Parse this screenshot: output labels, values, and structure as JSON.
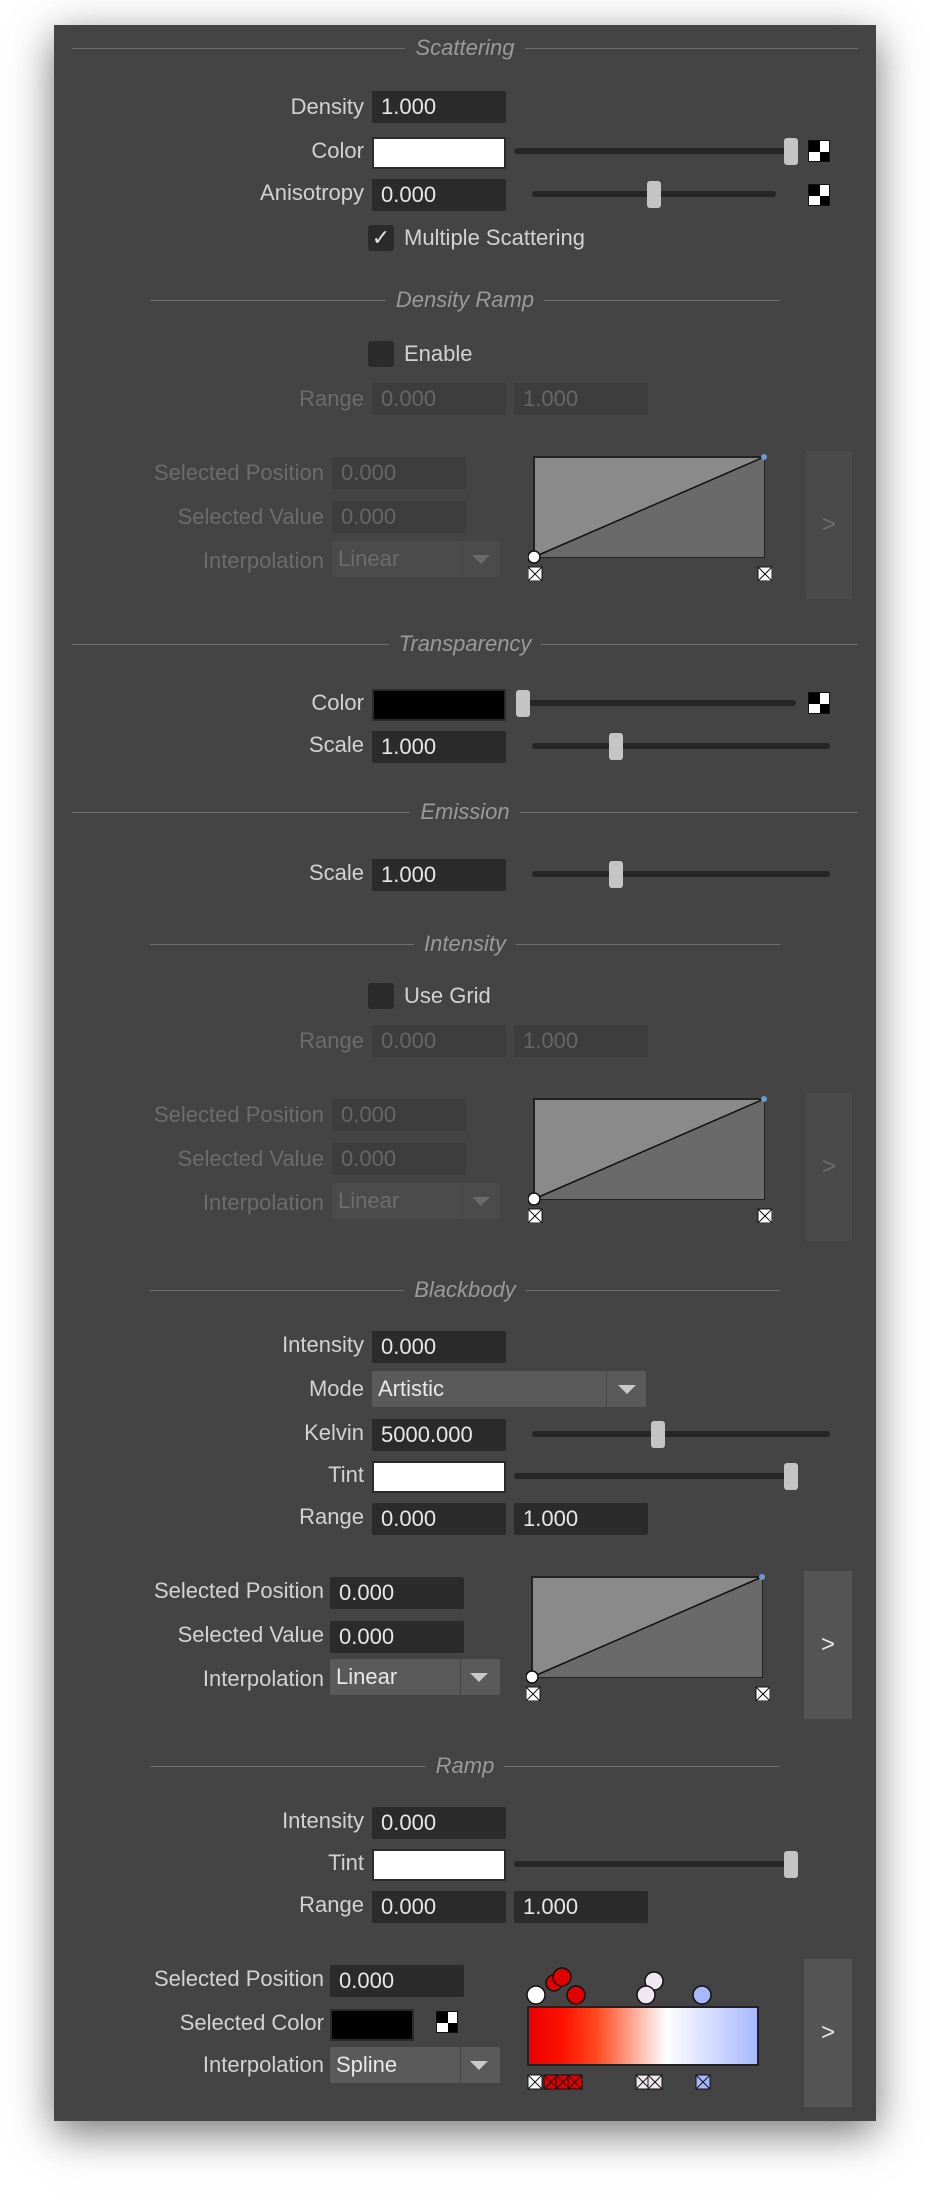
{
  "scattering": {
    "title": "Scattering",
    "density_label": "Density",
    "density_value": "1.000",
    "color_label": "Color",
    "anisotropy_label": "Anisotropy",
    "anisotropy_value": "0.000",
    "multiple_scattering_label": "Multiple Scattering",
    "multiple_scattering_checked": true
  },
  "density_ramp": {
    "title": "Density Ramp",
    "enable_label": "Enable",
    "range_label": "Range",
    "range_min": "0.000",
    "range_max": "1.000",
    "selected_position_label": "Selected Position",
    "selected_position_value": "0.000",
    "selected_value_label": "Selected Value",
    "selected_value_value": "0.000",
    "interpolation_label": "Interpolation",
    "interpolation_value": "Linear",
    "expand_label": ">"
  },
  "transparency": {
    "title": "Transparency",
    "color_label": "Color",
    "scale_label": "Scale",
    "scale_value": "1.000"
  },
  "emission": {
    "title": "Emission",
    "scale_label": "Scale",
    "scale_value": "1.000"
  },
  "intensity": {
    "title": "Intensity",
    "use_grid_label": "Use Grid",
    "range_label": "Range",
    "range_min": "0.000",
    "range_max": "1.000",
    "selected_position_label": "Selected Position",
    "selected_position_value": "0.000",
    "selected_value_label": "Selected Value",
    "selected_value_value": "0.000",
    "interpolation_label": "Interpolation",
    "interpolation_value": "Linear",
    "expand_label": ">"
  },
  "blackbody": {
    "title": "Blackbody",
    "intensity_label": "Intensity",
    "intensity_value": "0.000",
    "mode_label": "Mode",
    "mode_value": "Artistic",
    "kelvin_label": "Kelvin",
    "kelvin_value": "5000.000",
    "tint_label": "Tint",
    "range_label": "Range",
    "range_min": "0.000",
    "range_max": "1.000",
    "selected_position_label": "Selected Position",
    "selected_position_value": "0.000",
    "selected_value_label": "Selected Value",
    "selected_value_value": "0.000",
    "interpolation_label": "Interpolation",
    "interpolation_value": "Linear",
    "expand_label": ">"
  },
  "ramp": {
    "title": "Ramp",
    "intensity_label": "Intensity",
    "intensity_value": "0.000",
    "tint_label": "Tint",
    "range_label": "Range",
    "range_min": "0.000",
    "range_max": "1.000",
    "selected_position_label": "Selected Position",
    "selected_position_value": "0.000",
    "selected_color_label": "Selected Color",
    "interpolation_label": "Interpolation",
    "interpolation_value": "Spline",
    "expand_label": ">"
  },
  "sliders": {
    "scattering_color": 1.0,
    "scattering_anisotropy": 0.5,
    "transparency_color": 0.0,
    "transparency_scale": 0.27,
    "emission_scale": 0.27,
    "blackbody_kelvin": 0.42,
    "blackbody_tint": 1.0,
    "ramp_tint": 1.0
  },
  "colors": {
    "panel_bg": "#444444",
    "scattering_color_swatch": "#ffffff",
    "transparency_color_swatch": "#000000",
    "blackbody_tint_swatch": "#ffffff",
    "ramp_tint_swatch": "#ffffff",
    "ramp_selected_color": "#000000",
    "ramp_gradient_stops": [
      "#f00000",
      "#ff3010",
      "#ffffff",
      "#aab8ff"
    ]
  },
  "icons": {
    "texture_button": "checker-icon",
    "expand_button": "chevron-right-icon",
    "dropdown": "chevron-down-icon",
    "checkbox": "checkmark-icon"
  }
}
